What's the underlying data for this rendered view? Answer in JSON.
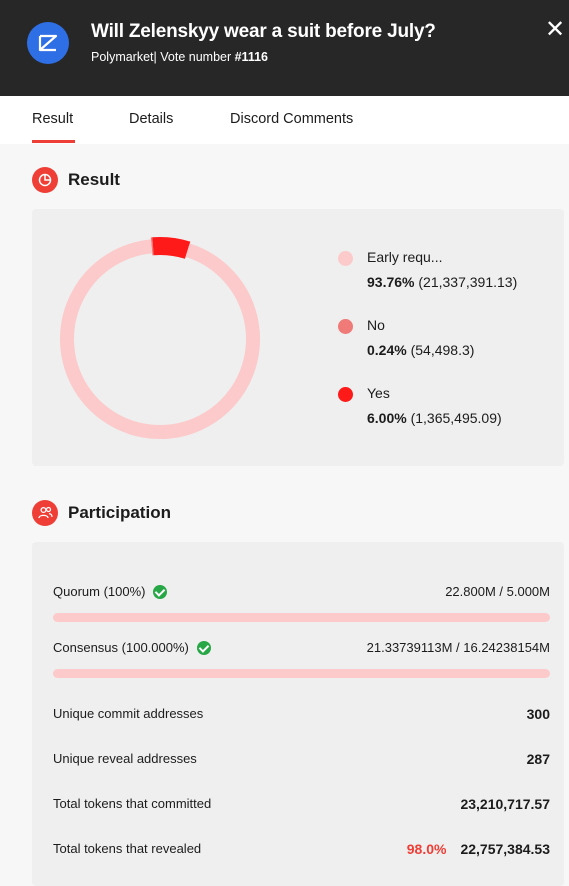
{
  "header": {
    "title": "Will Zelenskyy wear a suit before July?",
    "source": "Polymarket",
    "vote_prefix": "| Vote number ",
    "vote_number": "#1116",
    "close_glyph": "✕"
  },
  "tabs": [
    {
      "label": "Result",
      "active": true
    },
    {
      "label": "Details",
      "active": false
    },
    {
      "label": "Discord Comments",
      "active": false
    }
  ],
  "result": {
    "title": "Result",
    "icon": "pie-chart-icon",
    "chart_data": {
      "type": "pie",
      "categories": [
        "Early requ...",
        "No",
        "Yes"
      ],
      "values": [
        21337391.13,
        54498.3,
        1365495.09
      ],
      "percentages": [
        93.76,
        0.24,
        6.0
      ],
      "colors": [
        "#fccaca",
        "#f07a78",
        "#ff1a1a"
      ]
    },
    "legend": [
      {
        "name": "Early requ...",
        "pct": "93.76%",
        "amount": "(21,337,391.13)",
        "color": "#fccaca"
      },
      {
        "name": "No",
        "pct": "0.24%",
        "amount": "(54,498.3)",
        "color": "#f07a78"
      },
      {
        "name": "Yes",
        "pct": "6.00%",
        "amount": "(1,365,495.09)",
        "color": "#ff1a1a"
      }
    ]
  },
  "participation": {
    "title": "Participation",
    "icon": "users-icon",
    "quorum": {
      "label": "Quorum (100%)",
      "value": "22.800M / 5.000M",
      "progress": 1.0
    },
    "consensus": {
      "label": "Consensus (100.000%)",
      "value": "21.33739113M / 16.24238154M",
      "progress": 1.0
    },
    "stats": [
      {
        "label": "Unique commit addresses",
        "value": "300"
      },
      {
        "label": "Unique reveal addresses",
        "value": "287"
      },
      {
        "label": "Total tokens that committed",
        "value": "23,210,717.57"
      },
      {
        "label": "Total tokens that revealed",
        "pct": "98.0%",
        "value": "22,757,384.53"
      }
    ]
  }
}
